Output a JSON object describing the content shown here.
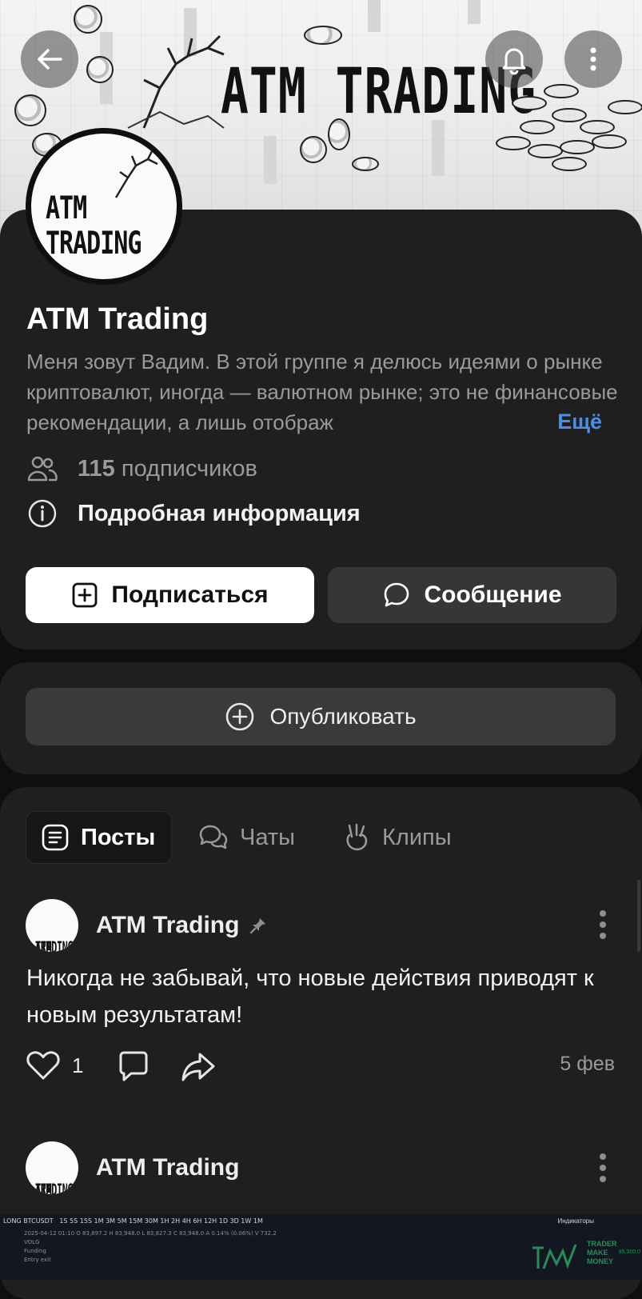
{
  "cover": {
    "title": "ATM TRADING",
    "back_icon": "arrow-left-icon",
    "bell_icon": "bell-icon",
    "menu_icon": "more-vertical-icon"
  },
  "avatar": {
    "line1": "ATM",
    "line2": "TRADING"
  },
  "group": {
    "name": "ATM Trading",
    "description": "Меня зовут Вадим. В этой группе я делюсь идеями о рынке криптовалют, иногда — валютном рынке; это не финансовые рекомендации, а лишь отображ",
    "more_label": "Ещё",
    "subscribers_count": "115",
    "subscribers_label": "подписчиков",
    "details_label": "Подробная информация"
  },
  "actions": {
    "subscribe_label": "Подписаться",
    "message_label": "Сообщение",
    "publish_label": "Опубликовать"
  },
  "tabs": [
    {
      "label": "Посты",
      "icon": "posts-icon",
      "active": true
    },
    {
      "label": "Чаты",
      "icon": "chats-icon",
      "active": false
    },
    {
      "label": "Клипы",
      "icon": "clips-icon",
      "active": false
    }
  ],
  "posts": [
    {
      "author": "ATM Trading",
      "pinned": true,
      "text": "Никогда не забывай, что новые действия приводят к новым результатам!",
      "likes": "1",
      "date": "5 фев"
    },
    {
      "author": "ATM Trading",
      "pinned": false
    }
  ],
  "chart_preview": {
    "symbol": "LONG BTCUSDT",
    "timeframes": "1S  5S  15S  1M  3M  5M  15M  30M  1H  2H  4H  6H  12H  1D  3D  1W  1M",
    "indicators_label": "Индикаторы",
    "ohlc": "2025-04-12 01:10   O 83,897.2   H 83,948.0   L 83,827.3   C 83,948.0   A 0.14%   (0.06%)   V 732.2",
    "rows": [
      "VOLG",
      "Funding",
      "Entry exit"
    ],
    "brand": [
      "TRADER",
      "MAKE",
      "MONEY"
    ],
    "price": "85,000.0"
  },
  "colors": {
    "background": "#0f0f10",
    "card": "#1f1f20",
    "accent_link": "#4a8fe8",
    "muted_text": "#9a9a9c"
  }
}
